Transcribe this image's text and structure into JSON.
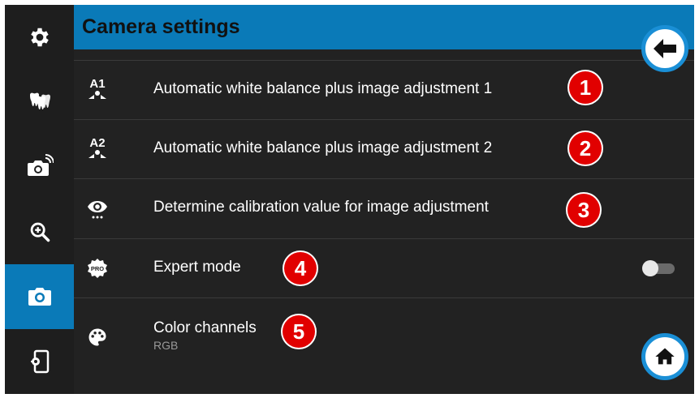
{
  "header": {
    "title": "Camera settings"
  },
  "sidebar": {
    "items": [
      {
        "icon": "gear-icon",
        "active": false
      },
      {
        "icon": "teeth-icon",
        "active": false
      },
      {
        "icon": "camera-wireless-icon",
        "active": false
      },
      {
        "icon": "zoom-in-icon",
        "active": false
      },
      {
        "icon": "camera-icon",
        "active": true
      },
      {
        "icon": "exit-app-icon",
        "active": false
      }
    ]
  },
  "settings": {
    "rows": [
      {
        "icon": "a1-white-balance-icon",
        "label": "Automatic white balance plus image adjustment 1",
        "badge": "1"
      },
      {
        "icon": "a2-white-balance-icon",
        "label": "Automatic white balance plus image adjustment 2",
        "badge": "2"
      },
      {
        "icon": "eye-calibration-icon",
        "label": "Determine calibration value for image adjustment",
        "badge": "3"
      },
      {
        "icon": "pro-icon",
        "label": "Expert mode",
        "badge": "4",
        "toggle_on": false
      },
      {
        "icon": "palette-icon",
        "label": "Color channels",
        "sublabel": "RGB",
        "badge": "5"
      }
    ]
  },
  "icon_text": {
    "a1": "A1",
    "a2": "A2",
    "pro": "PRO"
  },
  "buttons": {
    "back_icon": "arrow-left-icon",
    "home_icon": "home-icon"
  },
  "colors": {
    "accent": "#0a7ab8",
    "fab_ring": "#1a8fd6",
    "badge": "#e10000",
    "panel": "#222222",
    "sidebar": "#1e1e1e"
  }
}
